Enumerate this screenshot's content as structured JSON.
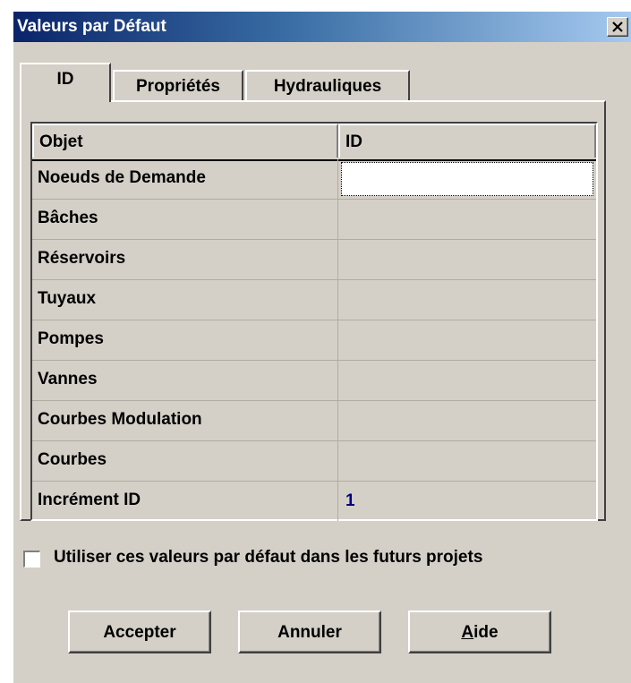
{
  "window": {
    "title": "Valeurs par Défaut"
  },
  "tabs": [
    {
      "label": "ID",
      "active": true
    },
    {
      "label": "Propriétés",
      "active": false
    },
    {
      "label": "Hydrauliques",
      "active": false
    }
  ],
  "grid": {
    "headers": [
      "Objet",
      "ID"
    ],
    "rows": [
      {
        "name": "Noeuds de Demande",
        "value": ""
      },
      {
        "name": "Bâches",
        "value": ""
      },
      {
        "name": "Réservoirs",
        "value": ""
      },
      {
        "name": "Tuyaux",
        "value": ""
      },
      {
        "name": "Pompes",
        "value": ""
      },
      {
        "name": "Vannes",
        "value": ""
      },
      {
        "name": "Courbes Modulation",
        "value": ""
      },
      {
        "name": "Courbes",
        "value": ""
      },
      {
        "name": "Incrément ID",
        "value": "1"
      }
    ]
  },
  "checkbox": {
    "label": "Utiliser ces valeurs par défaut dans les futurs projets",
    "checked": false
  },
  "buttons": {
    "accept": "Accepter",
    "cancel": "Annuler",
    "help": "Aide"
  },
  "colors": {
    "titlebar": "#0a246a",
    "face": "#d4d0c8",
    "value_text": "#000080"
  }
}
